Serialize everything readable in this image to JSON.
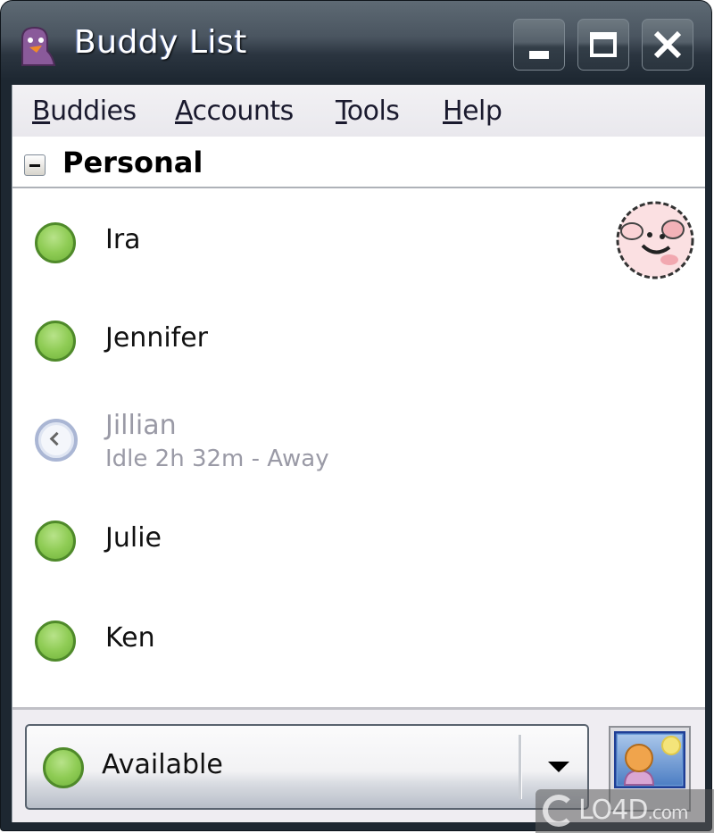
{
  "window": {
    "title": "Buddy List",
    "controls": {
      "minimize": "minimize",
      "maximize": "maximize",
      "close": "close"
    }
  },
  "menubar": {
    "items": [
      {
        "label_ul": "B",
        "label_rest": "uddies",
        "label": "Buddies"
      },
      {
        "label_ul": "A",
        "label_rest": "ccounts",
        "label": "Accounts"
      },
      {
        "label_ul": "T",
        "label_rest": "ools",
        "label": "Tools"
      },
      {
        "label_ul": "H",
        "label_rest": "elp",
        "label": "Help"
      }
    ]
  },
  "group": {
    "label": "Personal",
    "expanded": true
  },
  "buddies": [
    {
      "name": "Ira",
      "status": "available",
      "has_icon": true,
      "icon": "pig-avatar"
    },
    {
      "name": "Jennifer",
      "status": "available"
    },
    {
      "name": "Jillian",
      "status": "idle",
      "subtext": "Idle 2h 32m - Away"
    },
    {
      "name": "Julie",
      "status": "available"
    },
    {
      "name": "Ken",
      "status": "available"
    }
  ],
  "status_selector": {
    "value": "Available",
    "icon": "available-status-icon"
  },
  "colors": {
    "available": "#8fcc55",
    "idle_text": "#9a9aa6",
    "titlebar": "#2b3540"
  },
  "watermark": {
    "text": "LO4D",
    "suffix": ".com"
  }
}
